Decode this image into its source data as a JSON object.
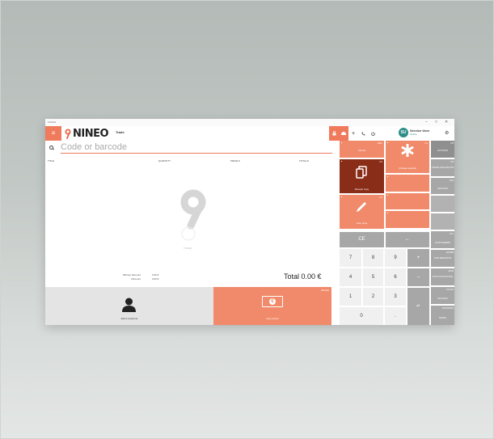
{
  "window": {
    "title": "In Point",
    "controls": [
      "–",
      "□",
      "✕"
    ]
  },
  "header": {
    "menu_icon": "hamburger-icon",
    "logo_text": "NINEO",
    "module": "Trade",
    "icons": [
      "lock-icon",
      "printer-icon",
      "plus-icon",
      "phone-icon",
      "power-icon"
    ],
    "user": {
      "initials": "SU",
      "name": "Service User",
      "status": "Online"
    },
    "settings_icon": "gear-icon"
  },
  "search": {
    "placeholder": "Code or barcode",
    "value": ""
  },
  "table": {
    "columns": [
      "TITLE",
      "QUANTITY",
      "PRICE €",
      "TOTAL €"
    ],
    "rows": []
  },
  "watermark": {
    "label": "TRADE"
  },
  "totals": {
    "without_discount_label": "Without discount",
    "without_discount_value": "0.00 €",
    "discount_label": "Discount",
    "discount_value": "0.00 €",
    "total_label": "Total",
    "total_value": "0.00 €"
  },
  "actions": {
    "add_customer": "Add a customer",
    "pay": {
      "label": "Pay receipt",
      "key": "SPACE"
    }
  },
  "tiles": {
    "cancel": {
      "label": "Cancel",
      "key": "DEL"
    },
    "change_quantity": {
      "label": "Change quantity",
      "key": "F1"
    },
    "receipt_copy": {
      "label": "Receipt copy",
      "key": "F2"
    },
    "free_price": {
      "label": "Free price",
      "key": "F4"
    }
  },
  "numpad": {
    "ce": "CE",
    "backspace": "←",
    "keys": [
      "7",
      "8",
      "9",
      "4",
      "5",
      "6",
      "1",
      "2",
      "3",
      "0"
    ],
    "plus": "+",
    "minus": "–",
    "enter": "↵",
    "dot": "."
  },
  "sidebar": [
    {
      "key": "F8",
      "label": "ACTIONS"
    },
    {
      "key": "F9",
      "label": "ITEMS DISCOUNTS"
    },
    {
      "key": "F10",
      "label": "GROUPS"
    },
    {
      "key": "",
      "label": ""
    },
    {
      "key": "",
      "label": ""
    },
    {
      "key": "F11",
      "label": "CUSTOMERS"
    },
    {
      "key": "HOME",
      "label": "POS REPORTS"
    },
    {
      "key": "END",
      "label": "POS FUNCTIONS"
    },
    {
      "key": "PGUP",
      "label": "INVOICE"
    },
    {
      "key": "PGDOWN",
      "label": "SIGNS"
    }
  ],
  "colors": {
    "accent": "#ef7a5c",
    "accent_dark": "#8a2d18",
    "side_gray": "#a7a7a7",
    "user_teal": "#2d8d88"
  }
}
